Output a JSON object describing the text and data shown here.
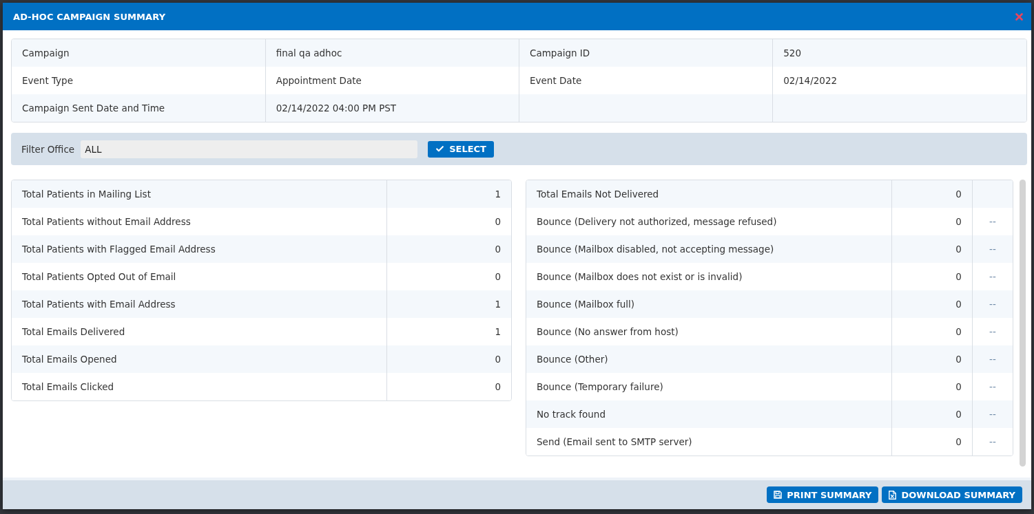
{
  "dialog": {
    "title": "AD-HOC CAMPAIGN SUMMARY"
  },
  "details": [
    {
      "cells": [
        "Campaign",
        "final qa adhoc",
        "Campaign ID",
        "520"
      ]
    },
    {
      "cells": [
        "Event Type",
        "Appointment Date",
        "Event Date",
        "02/14/2022"
      ]
    },
    {
      "cells": [
        "Campaign Sent Date and Time",
        "02/14/2022 04:00 PM PST"
      ]
    }
  ],
  "filter": {
    "label": "Filter Office",
    "value": "ALL",
    "button": "SELECT"
  },
  "patient_stats": [
    {
      "label": "Total Patients in Mailing List",
      "value": "1"
    },
    {
      "label": "Total Patients without Email Address",
      "value": "0"
    },
    {
      "label": "Total Patients with Flagged Email Address",
      "value": "0"
    },
    {
      "label": "Total Patients Opted Out of Email",
      "value": "0"
    },
    {
      "label": "Total Patients with Email Address",
      "value": "1"
    },
    {
      "label": "Total Emails Delivered",
      "value": "1"
    },
    {
      "label": "Total Emails Opened",
      "value": "0"
    },
    {
      "label": "Total Emails Clicked",
      "value": "0"
    }
  ],
  "delivery_stats": [
    {
      "label": "Total Emails Not Delivered",
      "value": "0"
    },
    {
      "label": "Bounce (Delivery not authorized, message refused)",
      "value": "0",
      "detail": "--"
    },
    {
      "label": "Bounce (Mailbox disabled, not accepting message)",
      "value": "0",
      "detail": "--"
    },
    {
      "label": "Bounce (Mailbox does not exist or is invalid)",
      "value": "0",
      "detail": "--"
    },
    {
      "label": "Bounce (Mailbox full)",
      "value": "0",
      "detail": "--"
    },
    {
      "label": "Bounce (No answer from host)",
      "value": "0",
      "detail": "--"
    },
    {
      "label": "Bounce (Other)",
      "value": "0",
      "detail": "--"
    },
    {
      "label": "Bounce (Temporary failure)",
      "value": "0",
      "detail": "--"
    },
    {
      "label": "No track found",
      "value": "0",
      "detail": "--"
    },
    {
      "label": "Send (Email sent to SMTP server)",
      "value": "0",
      "detail": "--"
    }
  ],
  "footer_buttons": [
    {
      "kind": "print",
      "label": "PRINT SUMMARY"
    },
    {
      "kind": "download",
      "label": "DOWNLOAD SUMMARY"
    }
  ]
}
